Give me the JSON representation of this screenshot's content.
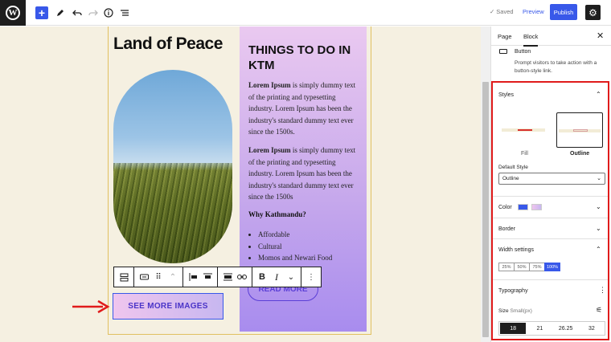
{
  "topbar": {
    "saved_label": "Saved",
    "preview_label": "Preview",
    "publish_label": "Publish"
  },
  "content": {
    "land_title": "Land of Peace",
    "things_title": "THINGS TO DO IN KTM",
    "para1_bold": "Lorem Ipsum",
    "para1_rest": " is simply dummy text of the printing and typesetting industry. Lorem Ipsum has been the industry's standard dummy text ever since the 1500s.",
    "para2_bold": "Lorem Ipsum",
    "para2_rest": " is simply dummy text of the printing and typesetting industry. Lorem Ipsum has been the industry's standard dummy text ever since the 1500s",
    "why_heading": "Why Kathmandu?",
    "list_items": [
      "Affordable",
      "Cultural",
      "Momos and Newari Food"
    ],
    "read_more_label": "READ MORE",
    "see_more_label": "SEE MORE IMAGES"
  },
  "sidebar": {
    "tab_page": "Page",
    "tab_block": "Block",
    "block_name": "Button",
    "block_description": "Prompt visitors to take action with a button-style link.",
    "styles_title": "Styles",
    "style_fill_label": "Fill",
    "style_outline_label": "Outline",
    "default_style_label": "Default Style",
    "default_style_value": "Outline",
    "color_title": "Color",
    "color_swatches": [
      "#3858e9",
      "#d9b8ef"
    ],
    "border_title": "Border",
    "width_title": "Width settings",
    "width_options": [
      "25%",
      "50%",
      "75%",
      "100%"
    ],
    "width_selected": "100%",
    "typography_title": "Typography",
    "size_label": "Size",
    "size_unit": "Small(px)",
    "size_options": [
      "18",
      "21",
      "26.25",
      "32"
    ],
    "size_selected": "18"
  },
  "colors": {
    "accent": "#3858e9",
    "highlight_frame": "#e01b1b",
    "canvas_bg": "#f5f0e1"
  }
}
